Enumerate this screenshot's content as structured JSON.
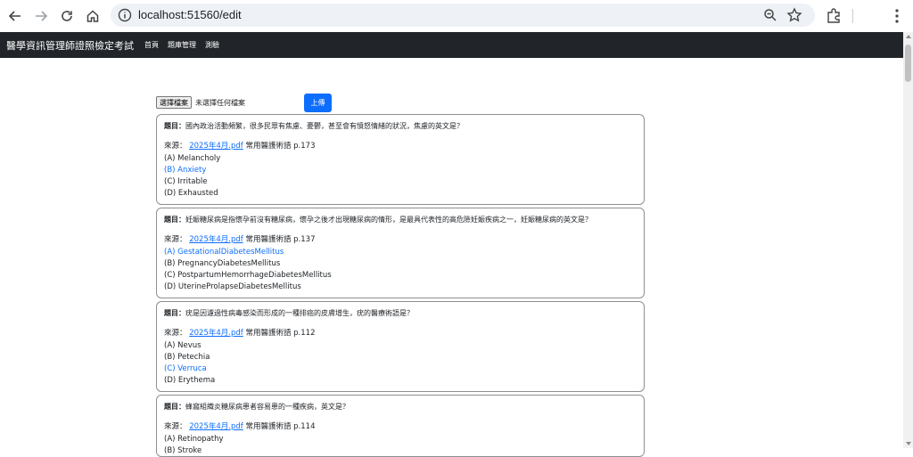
{
  "browser": {
    "url": "localhost:51560/edit"
  },
  "navbar": {
    "brand": "醫學資訊管理師證照檢定考試",
    "links": [
      "首頁",
      "題庫管理",
      "測驗"
    ]
  },
  "upload": {
    "choose_label": "選擇檔案",
    "no_file_label": "未選擇任何檔案",
    "upload_label": "上傳"
  },
  "labels": {
    "question_prefix": "題目：",
    "source_prefix": "來源："
  },
  "questions": [
    {
      "text": "國內政治活動頻繁，很多民眾有焦慮、憂鬱，甚至會有憤怒情緒的狀況，焦慮的英文是？",
      "source_file": "2025年4月.pdf",
      "source_ref": "常用醫護術語 p.173",
      "options": [
        "(A) Melancholy",
        "(B) Anxiety",
        "(C) Irritable",
        "(D) Exhausted"
      ],
      "answer_index": 1
    },
    {
      "text": "妊娠糖尿病是指懷孕前沒有糖尿病，懷孕之後才出現糖尿病的情形，是最具代表性的高危險妊娠疾病之一，妊娠糖尿病的英文是？",
      "source_file": "2025年4月.pdf",
      "source_ref": "常用醫護術語 p.137",
      "options": [
        "(A) GestationalDiabetesMellitus",
        "(B) PregnancyDiabetesMellitus",
        "(C) PostpartumHemorrhageDiabetesMellitus",
        "(D) UterineProlapseDiabetesMellitus"
      ],
      "answer_index": 0
    },
    {
      "text": "疣是因濾過性病毒感染而形成的一種排癌的皮膚增生，疣的醫療術語是？",
      "source_file": "2025年4月.pdf",
      "source_ref": "常用醫護術語 p.112",
      "options": [
        "(A) Nevus",
        "(B) Petechia",
        "(C) Verruca",
        "(D) Erythema"
      ],
      "answer_index": 2
    },
    {
      "text": "蜂窩組織炎糖尿病患者容易患的一種疾病，英文是？",
      "source_file": "2025年4月.pdf",
      "source_ref": "常用醫護術語 p.114",
      "options": [
        "(A) Retinopathy",
        "(B) Stroke",
        "",
        ""
      ],
      "answer_index": -1
    }
  ],
  "colors": {
    "navbar_bg": "#212529",
    "accent": "#0d6efd"
  }
}
